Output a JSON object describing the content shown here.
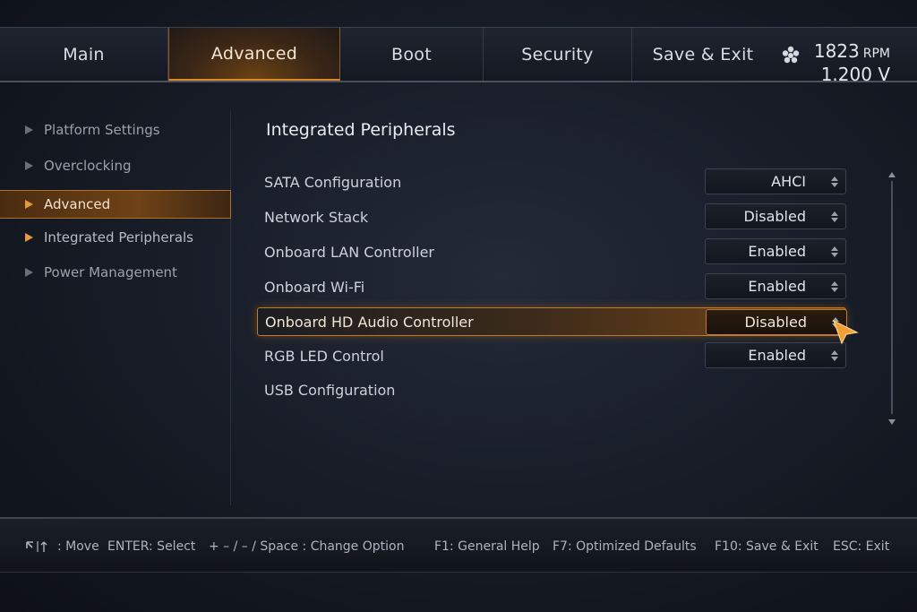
{
  "tabs": [
    {
      "label": "Main"
    },
    {
      "label": "Advanced"
    },
    {
      "label": "Boot"
    },
    {
      "label": "Security"
    },
    {
      "label": "Save & Exit"
    }
  ],
  "status": {
    "fan_icon": "fan-icon",
    "rpm_value": "1823",
    "rpm_unit": "RPM",
    "voltage": "1.200 V"
  },
  "sidebar": {
    "items": [
      {
        "label": "Platform Settings"
      },
      {
        "label": "Overclocking"
      },
      {
        "label": "Advanced"
      },
      {
        "label": "Integrated Peripherals"
      },
      {
        "label": "Power Management"
      }
    ]
  },
  "main": {
    "title": "Integrated Peripherals",
    "rows": [
      {
        "label": "SATA Configuration",
        "value": "AHCI"
      },
      {
        "label": "Network Stack",
        "value": "Disabled"
      },
      {
        "label": "Onboard LAN Controller",
        "value": "Enabled"
      },
      {
        "label": "Onboard Wi-Fi",
        "value": "Enabled"
      },
      {
        "label": "Onboard HD Audio Controller",
        "value": "Disabled"
      },
      {
        "label": "RGB LED Control",
        "value": "Enabled"
      },
      {
        "label": "USB Configuration",
        "value": ""
      }
    ]
  },
  "footer": {
    "move": ": Move",
    "enter": "ENTER: Select",
    "change": "+ – / – / Space : Change Option",
    "f1": "F1: General Help",
    "f7": "F7: Optimized Defaults",
    "f10": "F10: Save & Exit",
    "esc": "ESC: Exit"
  },
  "colors": {
    "accent": "#d98a2b",
    "background": "#161b25"
  }
}
